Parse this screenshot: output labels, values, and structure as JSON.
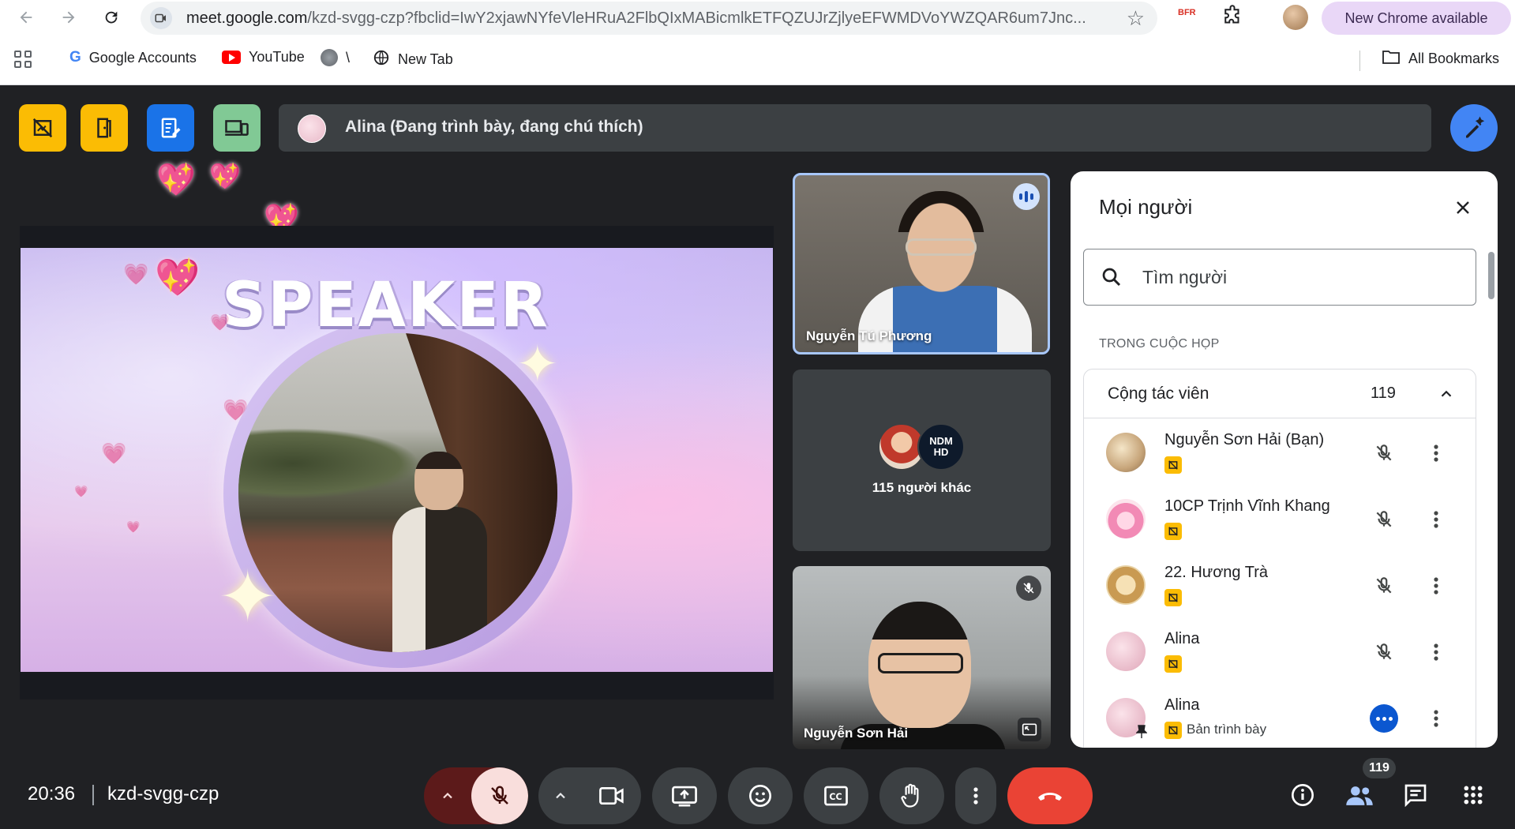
{
  "browser": {
    "url_host": "meet.google.com",
    "url_rest": "/kzd-svgg-czp?fbclid=IwY2xjawNYfeVleHRuA2FlbQIxMABicmlkETFQZUJrZjlyeEFWMDVoYWZQAR6um7Jnc...",
    "ext_label": "BFR",
    "new_chrome": "New Chrome available",
    "bookmarks": [
      "Google Accounts",
      "YouTube",
      "\\",
      "New Tab"
    ],
    "all_bookmarks": "All Bookmarks"
  },
  "meet": {
    "presenter_status": "Alina (Đang trình bày, đang chú thích)",
    "slide_title": "SPEAKER",
    "tiles": {
      "speaker1_name": "Nguyễn Tú Phương",
      "others_label": "115 người khác",
      "speaker2_name": "Nguyễn Sơn Hải",
      "others_avatar2_text": "NDM HD"
    },
    "time": "20:36",
    "meeting_code": "kzd-svgg-czp",
    "people_count_badge": "119"
  },
  "panel": {
    "title": "Mọi người",
    "search_placeholder": "Tìm người",
    "section_label": "TRONG CUỘC HỌP",
    "group_title": "Cộng tác viên",
    "group_count": "119",
    "people": [
      {
        "name": "Nguyễn Sơn Hải (Bạn)",
        "sub": ""
      },
      {
        "name": "10CP Trịnh Vĩnh Khang",
        "sub": ""
      },
      {
        "name": "22. Hương Trà",
        "sub": ""
      },
      {
        "name": "Alina",
        "sub": ""
      },
      {
        "name": "Alina",
        "sub": "Bản trình bày"
      }
    ]
  },
  "colors": {
    "meet_bg": "#202124",
    "accent_blue": "#4285f4",
    "end_call_red": "#ea4335",
    "tool_yellow": "#fbbc04",
    "tool_blue": "#1a73e8",
    "tool_green": "#81c995"
  }
}
